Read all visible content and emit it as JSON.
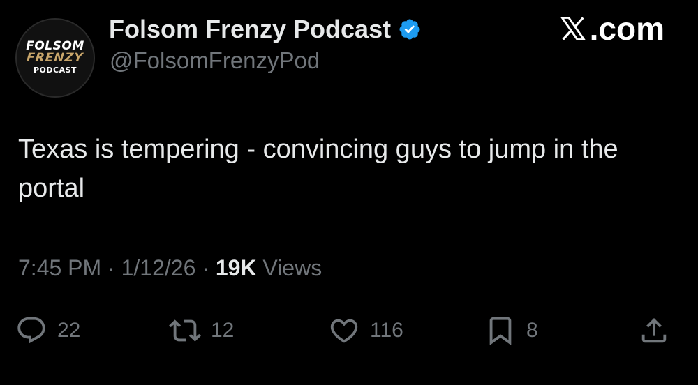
{
  "author": {
    "avatar_logo": {
      "line1": "FOLSOM",
      "line2": "FRENZY",
      "line3": "PODCAST"
    },
    "display_name": "Folsom Frenzy Podcast",
    "handle": "@FolsomFrenzyPod",
    "verified_color": "#1d9bf0"
  },
  "site_label": ".com",
  "tweet": {
    "text": "Texas is tempering - convincing guys to jump in the portal",
    "time": "7:45 PM",
    "separator": "·",
    "date": "1/12/26",
    "views_count": "19K",
    "views_label": "Views"
  },
  "actions": {
    "replies": "22",
    "reposts": "12",
    "likes": "116",
    "bookmarks": "8"
  },
  "icons": {
    "reply": "reply-icon",
    "repost": "repost-icon",
    "like": "heart-icon",
    "bookmark": "bookmark-icon",
    "share": "share-icon",
    "verified": "verified-badge-icon",
    "x_logo": "x-logo-icon"
  },
  "colors": {
    "background": "#000000",
    "primary_text": "#e7e9ea",
    "secondary_text": "#71767b",
    "accent_gold": "#c9a66b"
  }
}
